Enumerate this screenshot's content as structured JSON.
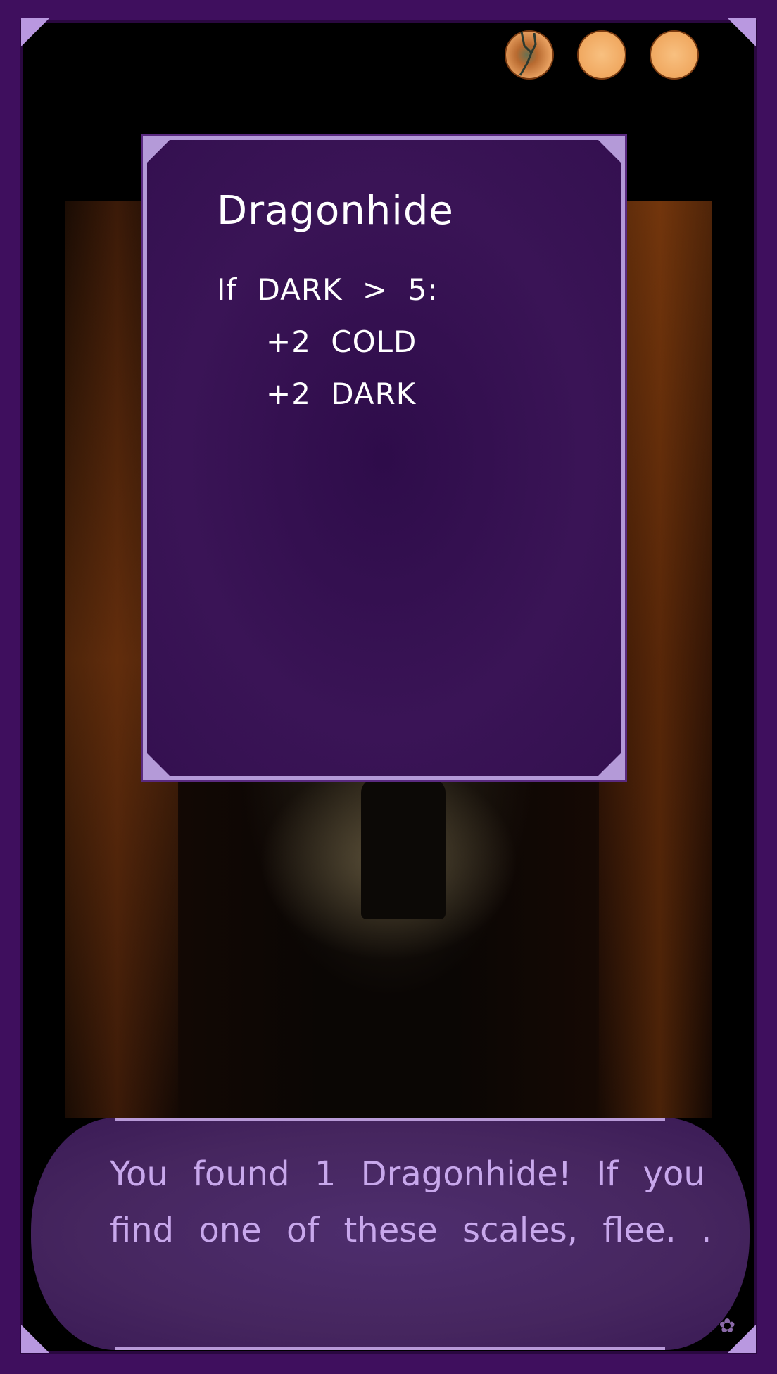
{
  "lives": {
    "total": 3,
    "cracked": 1,
    "orb_color": "#f0a860"
  },
  "card": {
    "title": "Dragonhide",
    "effects": [
      "If DARK > 5:",
      "+2 COLD",
      "+2 DARK"
    ]
  },
  "dialog": {
    "text": "You found 1 Dragonhide! If you find one of these scales, flee. ."
  },
  "colors": {
    "frame": "#3f0f5e",
    "card_border": "#b49ad8",
    "card_bg": "#341050",
    "dialog_text": "#c8a8ec"
  },
  "icons": {
    "settings": "gear-icon"
  }
}
